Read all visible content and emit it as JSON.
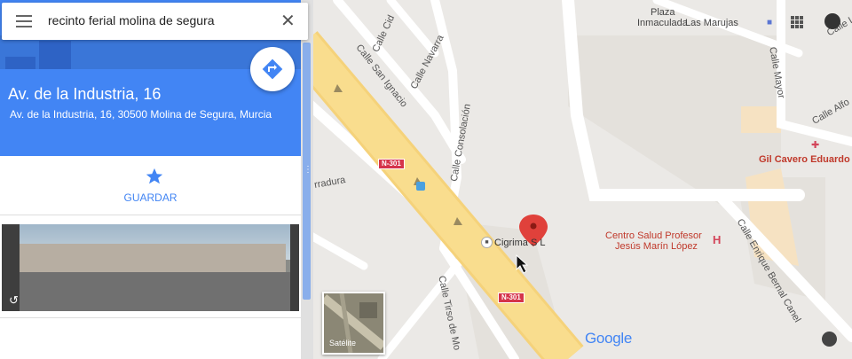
{
  "search": {
    "value": "recinto ferial molina de segura"
  },
  "place": {
    "title": "Av. de la Industria, 16",
    "address": "Av. de la Industria, 16, 30500 Molina de Segura, Murcia"
  },
  "actions": {
    "save_label": "GUARDAR"
  },
  "map": {
    "labels": {
      "plaza_1": "Plaza",
      "plaza_2": "Inmaculada",
      "las_marujas": "Las Marujas",
      "calle_cid": "Calle Cid",
      "calle_navarra": "Calle Navarra",
      "calle_san_ignacio": "Calle San Ignacio",
      "calle_consolacion": "Calle Consolación",
      "herradura": "rradura",
      "calle_mayor": "Calle Mayor",
      "calle_alfo": "Calle Alfo",
      "calle_top": "Calle Le",
      "gil_cavero": "Gil Cavero Eduardo J",
      "centro_salud_1": "Centro Salud Profesor",
      "centro_salud_2": "Jesús Marín López",
      "cigrima": "Cigrima S L",
      "calle_tirso": "Calle Tirso de Mo",
      "calle_enrique": "Calle Enrique Bernal Canel",
      "shield_n301_a": "N-301",
      "shield_n301_b": "N-301",
      "satellite": "Satélite",
      "google": "Google"
    }
  },
  "colors": {
    "accent": "#4285f4",
    "road_main": "#f9dd8e",
    "pin": "#e0413b"
  }
}
